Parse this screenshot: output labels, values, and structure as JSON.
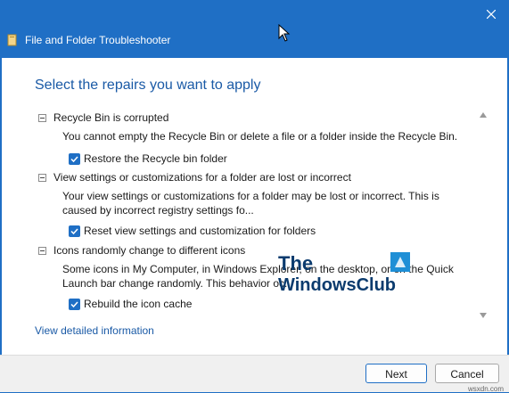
{
  "window": {
    "title": "File and Folder Troubleshooter"
  },
  "header": {
    "title": "Select the repairs you want to apply"
  },
  "items": [
    {
      "title": "Recycle Bin is corrupted",
      "description": "You cannot empty the Recycle Bin or delete a file or a folder inside the Recycle Bin.",
      "option_label": "Restore the Recycle bin folder",
      "checked": true
    },
    {
      "title": "View settings or customizations for a folder are lost or incorrect",
      "description": "Your view settings or customizations for a folder may be lost or incorrect. This is caused by incorrect registry settings fo...",
      "option_label": "Reset view settings and customization for folders",
      "checked": true
    },
    {
      "title": "Icons randomly change to different icons",
      "description": "Some icons in My Computer, in Windows Explorer, on the desktop, or on the Quick Launch bar change randomly. This behavior oc...",
      "option_label": "Rebuild the icon cache",
      "checked": true
    }
  ],
  "watermark": {
    "line1": "The",
    "line2": "WindowsClub"
  },
  "links": {
    "detail": "View detailed information"
  },
  "buttons": {
    "next": "Next",
    "cancel": "Cancel"
  },
  "footer_site": "wsxdn.com",
  "icons": {
    "title": "folder-icon",
    "close": "close-icon",
    "collapse": "minus-box-icon",
    "check": "checkmark-icon"
  },
  "colors": {
    "accent": "#1f6fc5",
    "heading": "#1a5aa6"
  }
}
